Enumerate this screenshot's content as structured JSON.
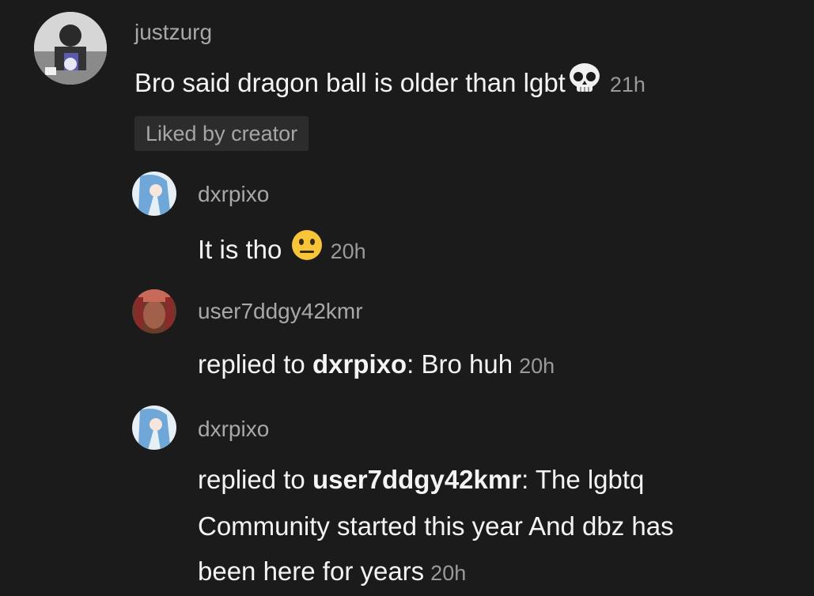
{
  "thread": {
    "top_comment": {
      "username": "justzurg",
      "text": "Bro said dragon ball is older than lgbt",
      "emoji": "skull-emoji",
      "time": "21h",
      "badge": "Liked by creator"
    },
    "replies": [
      {
        "username": "dxrpixo",
        "text": "It is tho",
        "emoji": "neutral-face-emoji",
        "time": "20h"
      },
      {
        "username": "user7ddgy42kmr",
        "reply_prefix": "replied to",
        "reply_target": "dxrpixo",
        "separator": ":",
        "text": " Bro huh",
        "time": "20h"
      },
      {
        "username": "dxrpixo",
        "reply_prefix": "replied to",
        "reply_target": "user7ddgy42kmr",
        "separator": ":",
        "line1": " The lgbtq",
        "line2": "Community started this year And dbz has",
        "line3": "been here for years",
        "time": "20h"
      }
    ]
  },
  "colors": {
    "background": "#1b1b1b",
    "username": "#a8a8a8",
    "text": "#f4f4f4",
    "time": "#9a9a9a",
    "badge_bg": "#2c2c2c"
  }
}
